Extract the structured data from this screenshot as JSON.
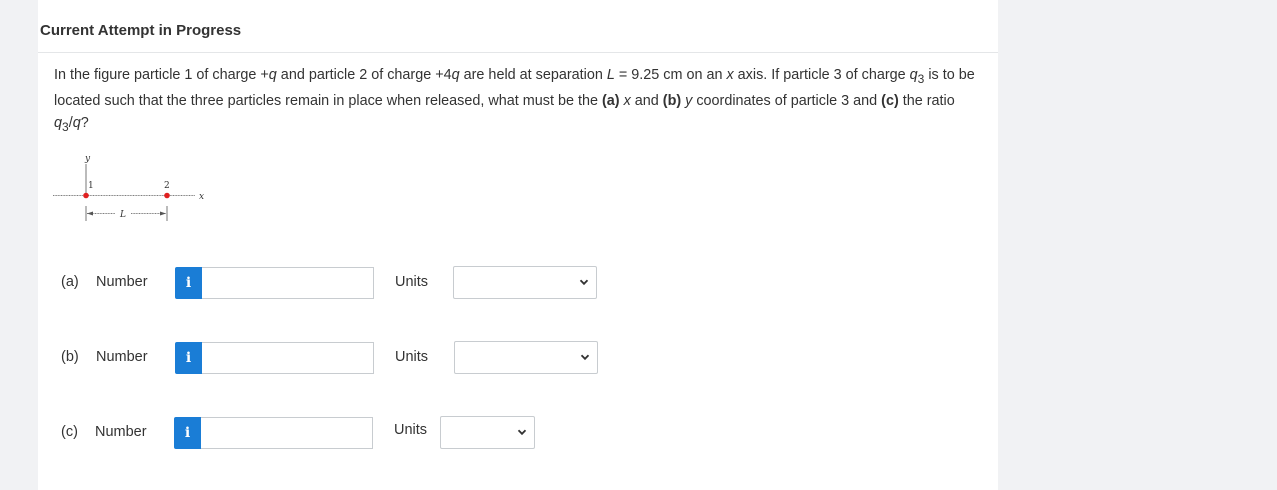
{
  "header": {
    "title": "Current Attempt in Progress"
  },
  "question": {
    "p1": "In the figure particle 1 of charge +",
    "q1": "q",
    "p2": " and particle 2 of charge +4",
    "q2": "q",
    "p3": " are held at separation ",
    "L": "L",
    "p4": " = 9.25 cm on an ",
    "x": "x",
    "p5": " axis. If particle 3 of charge ",
    "q3": "q",
    "q3sub": "3",
    "p6": " is to be located such that the three particles remain in place when released, what must be the ",
    "a": "(a)",
    "p7": " ",
    "xa": "x",
    "p8": " and ",
    "b": "(b)",
    "p9": " ",
    "yb": "y",
    "p10": " coordinates of particle 3 and ",
    "c": "(c)",
    "p11": " the ratio ",
    "ratio_q3": "q",
    "ratio_sub": "3",
    "ratio_rest": "/",
    "ratio_q": "q",
    "ratio_end": "?"
  },
  "figure": {
    "y_axis": "y",
    "x_axis": "x",
    "particle1": "1",
    "particle2": "2",
    "separation": "L",
    "particle_color": "#e02020"
  },
  "answers": [
    {
      "part": "(a)",
      "number_label": "Number",
      "info": "i",
      "value": "",
      "units_label": "Units",
      "units_selected": ""
    },
    {
      "part": "(b)",
      "number_label": "Number",
      "info": "i",
      "value": "",
      "units_label": "Units",
      "units_selected": ""
    },
    {
      "part": "(c)",
      "number_label": "Number",
      "info": "i",
      "value": "",
      "units_label": "Units",
      "units_selected": ""
    }
  ],
  "colors": {
    "info_button": "#1a7dd6",
    "border": "#c8ccd0"
  }
}
